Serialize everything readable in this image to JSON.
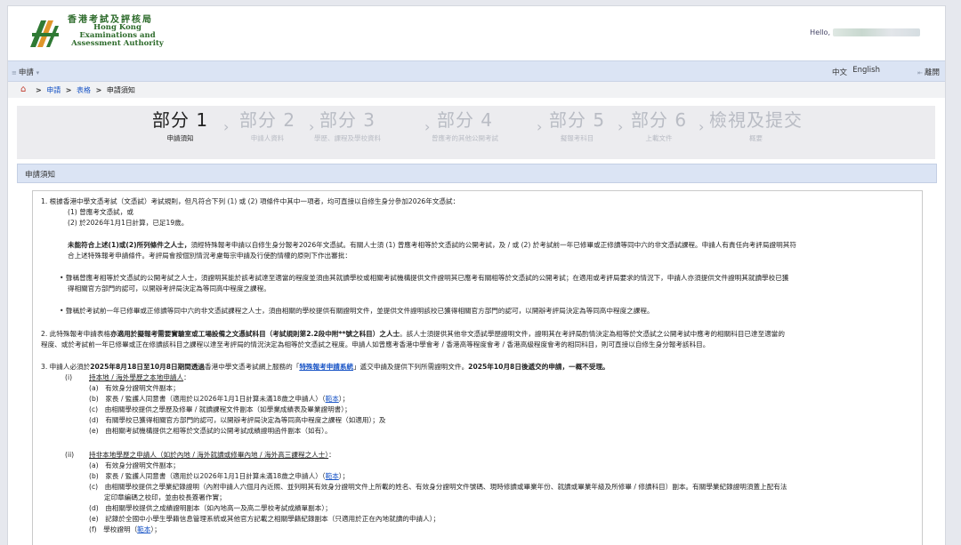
{
  "header": {
    "logo_zh": "香港考試及評核局",
    "logo_en_1": "Hong Kong",
    "logo_en_2": "Examinations and",
    "logo_en_3": "Assessment Authority",
    "hello": "Hello,"
  },
  "menubar": {
    "apply": "申請",
    "lang_zh": "中文",
    "lang_en": "English",
    "logout": "離開"
  },
  "breadcrumb": [
    "申請",
    "表格",
    "申請須知"
  ],
  "steps": [
    {
      "title": "部分 1",
      "sub": "申請須知",
      "active": true
    },
    {
      "title": "部分 2",
      "sub": "申請人資料",
      "active": false
    },
    {
      "title": "部分 3",
      "sub": "學歷、課程及學校資料",
      "active": false
    },
    {
      "title": "部分 4",
      "sub": "曾應考的其他公開考試",
      "active": false
    },
    {
      "title": "部分 5",
      "sub": "擬報考科目",
      "active": false
    },
    {
      "title": "部分 6",
      "sub": "上載文件",
      "active": false
    },
    {
      "title": "檢視及提交",
      "sub": "概要",
      "active": false
    }
  ],
  "notice": {
    "heading": "申請須知",
    "p1": "1. 根據香港中學文憑考試（文憑試）考試規則，但凡符合下列 (1) 或 (2) 項條件中其中一項者，均可直接以自修生身分參加2026年文憑試：",
    "p1a": "(1) 曾應考文憑試，或",
    "p1b": "(2) 於2026年1月1日計算，已足19歲。",
    "p1c_bold": "未能符合上述(1)或(2)所列條件之人士，",
    "p1c_rest": "須經特殊報考申請以自修生身分報考2026年文憑試。有關人士須 (1) 曾應考相等於文憑試的公開考試，及 / 或 (2) 於考試前一年已修畢或正修讀等同中六的非文憑試課程。申請人有責任向考評局證明其符",
    "p1d": "合上述特殊報考申請條件。考評局會按個別情況考慮每宗申請及行使酌情權的原則下作出審批：",
    "b1": "• 聲稱曾應考相等於文憑試的公開考試之人士，須證明其能於該考試達至適當的程度並須由其就讀學校或相關考試機構提供文件證明其已應考有關相等於文憑試的公開考試；在適用或考評局要求的情況下，申請人亦須提供文件證明其就讀學校已獲",
    "b1b": "得相關官方部門的認可，以開辦考評局決定為等同高中程度之課程。",
    "b2": "• 聲稱於考試前一年已修畢或正修讀等同中六的非文憑試課程之人士，須由相關的學校提供有關證明文件，並提供文件證明該校已獲得相關官方部門的認可，以開辦考評局決定為等同高中程度之課程。",
    "p2a": "2. 此特殊報考申請表格",
    "p2b_bold": "亦適用於擬報考需要實驗室或工場設備之文憑試科目（考試規則第2.2段中附**號之科目）之人士",
    "p2c": "。該人士須提供其他非文憑試學歷證明文件，證明其在考評局酌情決定為相等於文憑試之公開考試中應考的相關科目已達至適當的",
    "p2d": "程度、或於考試前一年已修畢或正在修讀該科目之課程以達至考評局的情況決定為相等於文憑試之程度。申請人如曾應考香港中學會考 / 香港高等程度會考 / 香港高級程度會考的相同科目，則可直接以自修生身分報考該科目。",
    "p3a": "3. 申請人必須於",
    "p3b_bold": "2025年8月18日至10月8日期間透過",
    "p3c": "香港中學文憑考試網上服務的「",
    "p3d_link": "特殊報考申請系統",
    "p3e": "」遞交申請及提供下列所需證明文件。",
    "p3f_bold": "2025年10月8日後遞交的申請，一概不受理。",
    "i_label": "(i)",
    "i_title": "持本地 / 海外學歷之本地申請人",
    "i_a": "(a)　有效身分證明文件副本；",
    "i_b": "(b)　家長 / 監護人同意書（適用於以2026年1月1日計算未滿18歲之申請人）（",
    "i_b_link": "範本",
    "i_b_end": "）；",
    "i_c": "(c)　由相關學校提供之學歷及修畢 / 就讀課程文件副本（如學業成績表及畢業證明書）；",
    "i_d": "(d)　有關學校已獲得相關官方部門的認可，以開辦考評局決定為等同高中程度之課程（如適用）；及",
    "i_e": "(e)　由相關考試機構提供之相等於文憑試的公開考試成績證明函件副本（如有）。",
    "ii_label": "(ii)",
    "ii_title": "持非本地學歷之申請人（如於內地 / 海外就讀或修畢內地 / 海外高三課程之人士）",
    "ii_a": "(a)　有效身分證明文件副本；",
    "ii_b": "(b)　家長 / 監護人同意書（適用於以2026年1月1日計算未滿18歲之申請人）（",
    "ii_b_link": "範本",
    "ii_b_end": "）；",
    "ii_c": "(c)　由相關學校提供之學業紀錄證明（內附申請人六個月內近照、並列明其有效身分證明文件上所載的姓名、有效身分證明文件號碼、現時修讀或畢業年份、就讀或畢業年級及所修畢 / 修讀科目）副本。有關學業紀錄證明須蓋上配有法",
    "ii_c2": "定印章編碼之校印，並由校長簽署作實；",
    "ii_d": "(d)　由相關學校提供之成績證明副本（如內地高一及高二學校考試成績單副本）；",
    "ii_e": "(e)　記錄於全國中小學生學籍信息管理系統或其他官方記載之相關學籍紀錄副本（只適用於正在內地就讀的申請人）；",
    "ii_f": "(f)　學校證明（",
    "ii_f_link": "範本",
    "ii_f_end": "）；"
  }
}
